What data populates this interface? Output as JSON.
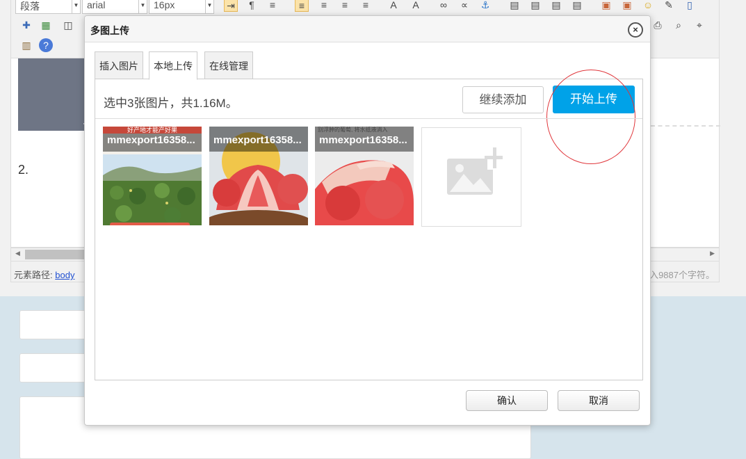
{
  "editor": {
    "toolbar": {
      "paragraph_select": "段落",
      "font_select": "arial",
      "size_select": "16px"
    },
    "content_text": "2.",
    "path_label": "元素路径:",
    "path_link": "body",
    "char_count": "入9887个字符。"
  },
  "dialog": {
    "title": "多图上传",
    "close_symbol": "×",
    "tabs": [
      {
        "label": "插入图片",
        "active": false
      },
      {
        "label": "本地上传",
        "active": true
      },
      {
        "label": "在线管理",
        "active": false
      }
    ],
    "status_text": "选中3张图片，共1.16M。",
    "add_more_label": "继续添加",
    "start_upload_label": "开始上传",
    "thumbnails": [
      {
        "name": "mmexport16358...",
        "caption": "好产地才能产好果"
      },
      {
        "name": "mmexport16358..."
      },
      {
        "name": "mmexport16358...",
        "caption": "别浮肿的葡萄, 将水纸液消入"
      }
    ],
    "confirm_label": "确认",
    "cancel_label": "取消"
  },
  "colors": {
    "primary": "#00a2e8",
    "annotation": "#e0353a",
    "overlay": "#6e7585"
  }
}
